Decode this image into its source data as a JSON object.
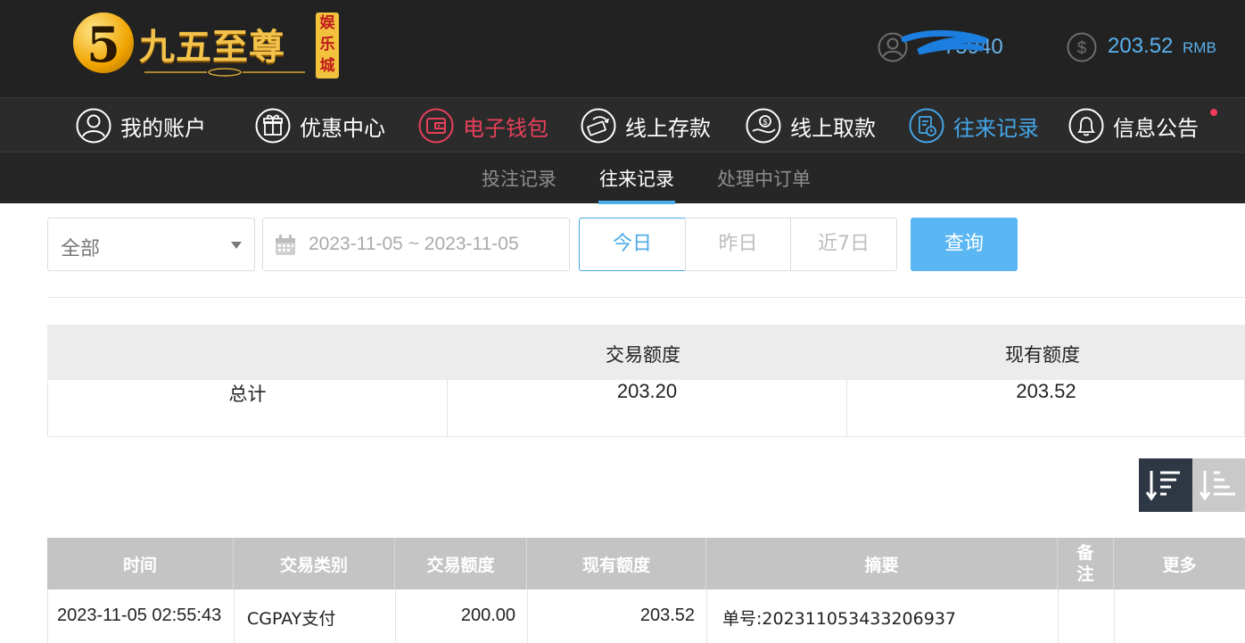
{
  "brand": {
    "badge_glyph": "5",
    "title": "九五至尊",
    "tag": [
      "娱",
      "乐",
      "城"
    ],
    "color_gold": "#f3c24a"
  },
  "account": {
    "username": "75940",
    "balance": "203.52",
    "currency": "RMB"
  },
  "main_nav": [
    {
      "label": "我的账户",
      "icon": "user-circle-icon"
    },
    {
      "label": "优惠中心",
      "icon": "gift-icon"
    },
    {
      "label": "电子钱包",
      "icon": "wallet-icon"
    },
    {
      "label": "线上存款",
      "icon": "deposit-icon"
    },
    {
      "label": "线上取款",
      "icon": "withdraw-icon"
    },
    {
      "label": "往来记录",
      "icon": "records-icon"
    },
    {
      "label": "信息公告",
      "icon": "bell-icon"
    }
  ],
  "sub_nav": [
    {
      "label": "投注记录"
    },
    {
      "label": "往来记录"
    },
    {
      "label": "处理中订单"
    }
  ],
  "filters": {
    "type_value": "全部",
    "date_range": "2023-11-05 ~ 2023-11-05",
    "ranges": [
      "今日",
      "昨日",
      "近7日"
    ],
    "query_label": "查询"
  },
  "summary": {
    "headers": [
      "",
      "交易额度",
      "现有额度"
    ],
    "row_label": "总计",
    "transaction_total": "203.20",
    "current_total": "203.52"
  },
  "records": {
    "headers": [
      "时间",
      "交易类别",
      "交易额度",
      "现有额度",
      "摘要",
      "备注",
      "更多"
    ],
    "rows": [
      {
        "time": "2023-11-05 02:55:43",
        "type": "CGPAY支付",
        "amount": "200.00",
        "balance": "203.52",
        "summary": "单号:202311053433206937",
        "remark": "",
        "more": ""
      }
    ]
  },
  "colors": {
    "accent_blue": "#4aaeea",
    "accent_red": "#e8405a",
    "header_bg": "#222222"
  }
}
